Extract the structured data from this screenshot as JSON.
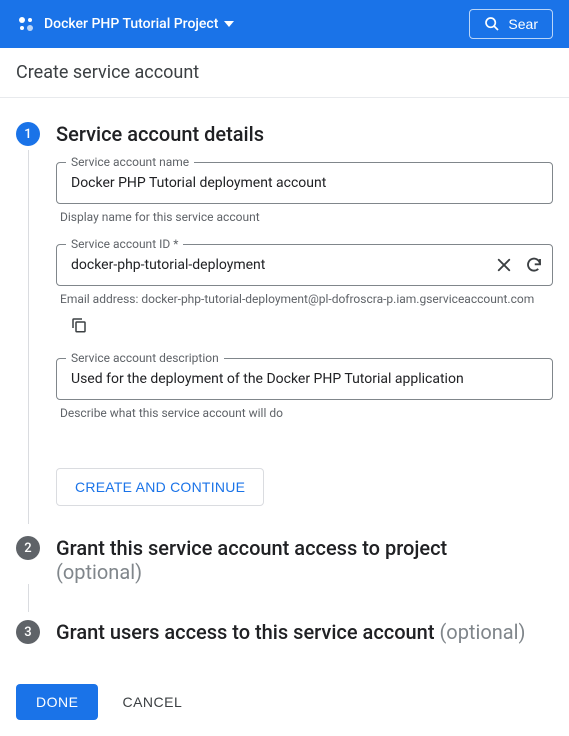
{
  "topbar": {
    "project_name": "Docker PHP Tutorial Project",
    "search_label": "Sear"
  },
  "subheader": {
    "title": "Create service account"
  },
  "step1": {
    "number": "1",
    "title": "Service account details",
    "name_field": {
      "label": "Service account name",
      "value": "Docker PHP Tutorial deployment account",
      "helper": "Display name for this service account"
    },
    "id_field": {
      "label": "Service account ID *",
      "value": "docker-php-tutorial-deployment",
      "email_prefix": "Email address: ",
      "email_value": "docker-php-tutorial-deployment@pl-dofroscra-p.iam.gserviceaccount.com"
    },
    "desc_field": {
      "label": "Service account description",
      "value": "Used for the deployment of the Docker PHP Tutorial application",
      "helper": "Describe what this service account will do"
    },
    "create_continue_label": "CREATE AND CONTINUE"
  },
  "step2": {
    "number": "2",
    "title": "Grant this service account access to project",
    "optional": "(optional)"
  },
  "step3": {
    "number": "3",
    "title": "Grant users access to this service account ",
    "optional": "(optional)"
  },
  "footer": {
    "done_label": "DONE",
    "cancel_label": "CANCEL"
  }
}
